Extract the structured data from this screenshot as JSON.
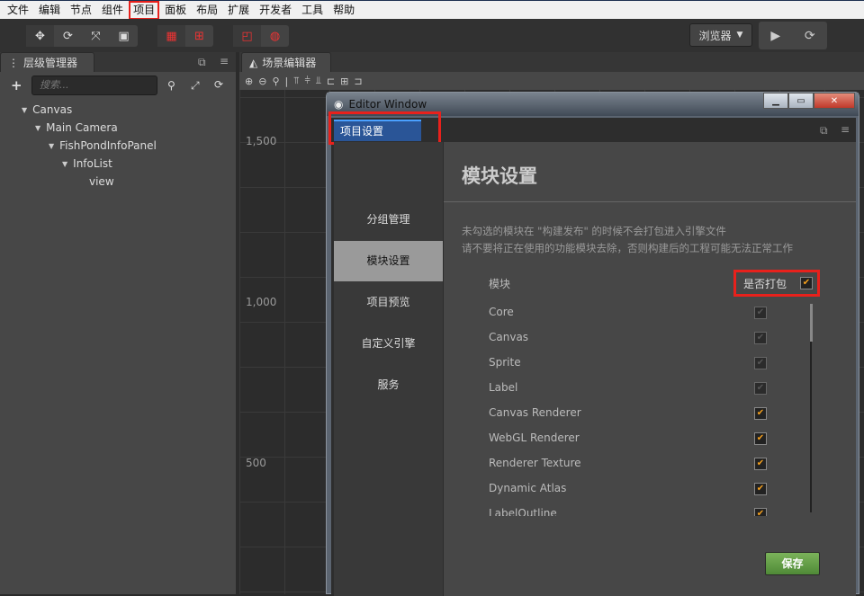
{
  "menu": [
    "文件",
    "编辑",
    "节点",
    "组件",
    "项目",
    "面板",
    "布局",
    "扩展",
    "开发者",
    "工具",
    "帮助"
  ],
  "toolbar": {
    "browser": "浏览器",
    "play_icon": "▶",
    "refresh_icon": "⟳"
  },
  "hierarchy": {
    "title": "层级管理器",
    "search_placeholder": "搜索...",
    "tree": [
      "Canvas",
      "Main Camera",
      "FishPondInfoPanel",
      "InfoList",
      "view"
    ]
  },
  "scene": {
    "title": "场景编辑器",
    "rulers": [
      "1,500",
      "1,000",
      "500"
    ]
  },
  "window": {
    "title": "Editor Window",
    "tab": "项目设置",
    "nav": [
      "分组管理",
      "模块设置",
      "项目预览",
      "自定义引擎",
      "服务"
    ],
    "heading": "模块设置",
    "desc": [
      "未勾选的模块在 \"构建发布\" 的时候不会打包进入引擎文件",
      "请不要将正在使用的功能模块去除，否则构建后的工程可能无法正常工作"
    ],
    "col_module": "模块",
    "col_pack": "是否打包",
    "modules": [
      {
        "name": "Core",
        "checked": true,
        "disabled": true
      },
      {
        "name": "Canvas",
        "checked": true,
        "disabled": true
      },
      {
        "name": "Sprite",
        "checked": true,
        "disabled": true
      },
      {
        "name": "Label",
        "checked": true,
        "disabled": true
      },
      {
        "name": "Canvas Renderer",
        "checked": true,
        "disabled": false
      },
      {
        "name": "WebGL Renderer",
        "checked": true,
        "disabled": false
      },
      {
        "name": "Renderer Texture",
        "checked": true,
        "disabled": false
      },
      {
        "name": "Dynamic Atlas",
        "checked": true,
        "disabled": false
      },
      {
        "name": "LabelOutline",
        "checked": true,
        "disabled": false
      }
    ],
    "save": "保存"
  },
  "colors": {
    "accent_check": "#f5a01c",
    "save": "#5f9c44",
    "tab_active": "#2a5597",
    "highlight": "#e8211c"
  }
}
